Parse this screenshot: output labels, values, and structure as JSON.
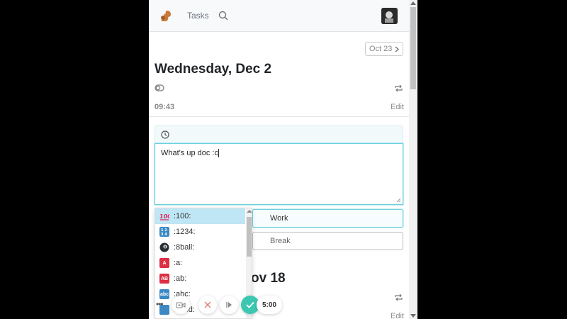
{
  "navbar": {
    "tasks_label": "Tasks"
  },
  "date_nav": {
    "label": "Oct 23"
  },
  "day": {
    "title": "Wednesday, Dec 2",
    "time": "09:43",
    "edit_label": "Edit"
  },
  "note": {
    "value": "What's up doc :c"
  },
  "buttons": {
    "work_label": "Work",
    "break_label": "Break"
  },
  "next_day": {
    "title_visible": "ov 18",
    "edit_label": "Edit"
  },
  "emoji_suggestions": [
    {
      "label": ":100:",
      "icon": "hundred-points-icon",
      "selected": true
    },
    {
      "label": ":1234:",
      "icon": "input-numbers-icon",
      "selected": false
    },
    {
      "label": ":8ball:",
      "icon": "pool-8-ball-icon",
      "selected": false
    },
    {
      "label": ":a:",
      "icon": "a-button-icon",
      "selected": false
    },
    {
      "label": ":ab:",
      "icon": "ab-button-icon",
      "selected": false
    },
    {
      "label": ":abc:",
      "icon": "abc-input-icon",
      "selected": false
    },
    {
      "label": ":abcd:",
      "icon": "abcd-input-icon",
      "selected": false
    }
  ],
  "emoji_glyphs": {
    "a": "A",
    "ab": "AB",
    "abc": "abc"
  },
  "timer": {
    "value": "5:00"
  },
  "colors": {
    "accent": "#3cc7b1",
    "focus": "#6cd0dd",
    "cancel": "#e07a7a",
    "selected_item": "#bfe6f4"
  }
}
